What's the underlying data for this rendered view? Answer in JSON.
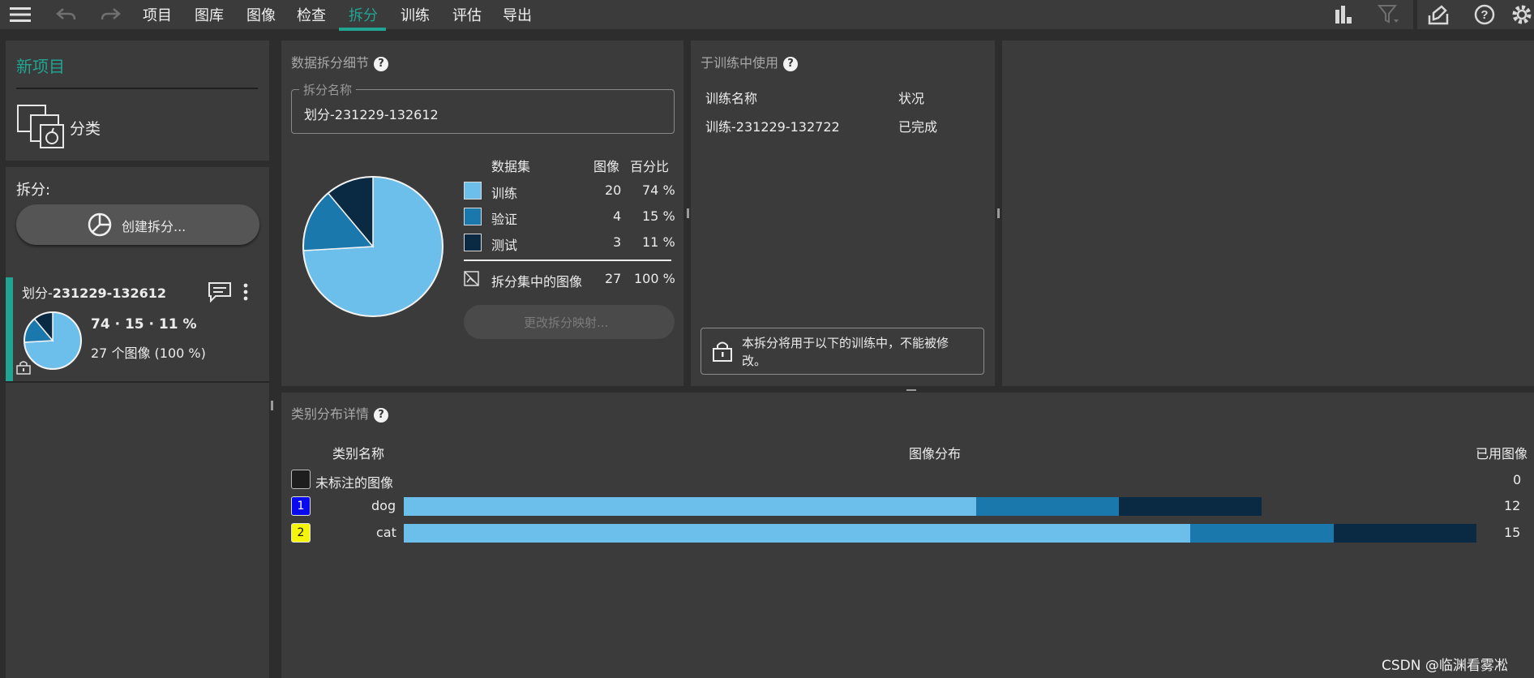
{
  "colors": {
    "accent": "#21a593",
    "train": "#6cbfea",
    "val": "#1a78ad",
    "test": "#092a42"
  },
  "menu": {
    "items": [
      {
        "label": "项目"
      },
      {
        "label": "图库"
      },
      {
        "label": "图像"
      },
      {
        "label": "检查"
      },
      {
        "label": "拆分"
      },
      {
        "label": "训练"
      },
      {
        "label": "评估"
      },
      {
        "label": "导出"
      }
    ],
    "active": "拆分"
  },
  "icons": {
    "menu": "hamburger-icon",
    "undo": "undo-icon",
    "redo": "redo-icon",
    "stats": "bar-chart-icon",
    "filter": "filter-icon",
    "feedback": "feedback-icon",
    "help": "help-icon",
    "settings": "gear-icon"
  },
  "sidebar": {
    "project_title": "新项目",
    "project_type": "分类",
    "splits_label": "拆分:",
    "create_label": "创建拆分...",
    "split_card": {
      "name_prefix": "划分-",
      "name_id": "231229-132612",
      "ratio": "74 · 15 · 11 %",
      "count": "27 个图像 (100 %)"
    }
  },
  "details": {
    "title": "数据拆分细节",
    "name_legend": "拆分名称",
    "name_value": "划分-231229-132612",
    "table_headers": [
      "数据集",
      "图像",
      "百分比"
    ],
    "rows": [
      {
        "name": "训练",
        "count": "20",
        "pct": "74 %"
      },
      {
        "name": "验证",
        "count": "4",
        "pct": "15 %"
      },
      {
        "name": "测试",
        "count": "3",
        "pct": "11 %"
      }
    ],
    "total_label": "拆分集中的图像",
    "total_count": "27",
    "total_pct": "100 %",
    "change_btn": "更改拆分映射..."
  },
  "usage": {
    "title": "于训练中使用",
    "headers": [
      "训练名称",
      "状况"
    ],
    "rows": [
      {
        "name": "训练-231229-132722",
        "status": "已完成"
      }
    ],
    "lock_note_l1": "本拆分将用于以下的训练中，不能被修",
    "lock_note_l2": "改。"
  },
  "classes": {
    "title": "类别分布详情",
    "headers": [
      "类别名称",
      "图像分布",
      "已用图像"
    ],
    "unlabeled": {
      "name": "未标注的图像",
      "count": "0"
    },
    "rows": [
      {
        "index": "1",
        "name": "dog",
        "count": "12",
        "badge_color": "#0a0af0",
        "badge_text_color": "#ffffff",
        "dist": [
          8,
          2,
          2
        ]
      },
      {
        "index": "2",
        "name": "cat",
        "count": "15",
        "badge_color": "#f5f50a",
        "badge_text_color": "#111111",
        "dist": [
          11,
          2,
          2
        ]
      }
    ]
  },
  "chart_data": {
    "type": "pie",
    "categories": [
      "训练",
      "验证",
      "测试"
    ],
    "values": [
      20,
      4,
      3
    ],
    "percent": [
      74,
      15,
      11
    ]
  },
  "watermark": "CSDN @临渊看雾凇"
}
